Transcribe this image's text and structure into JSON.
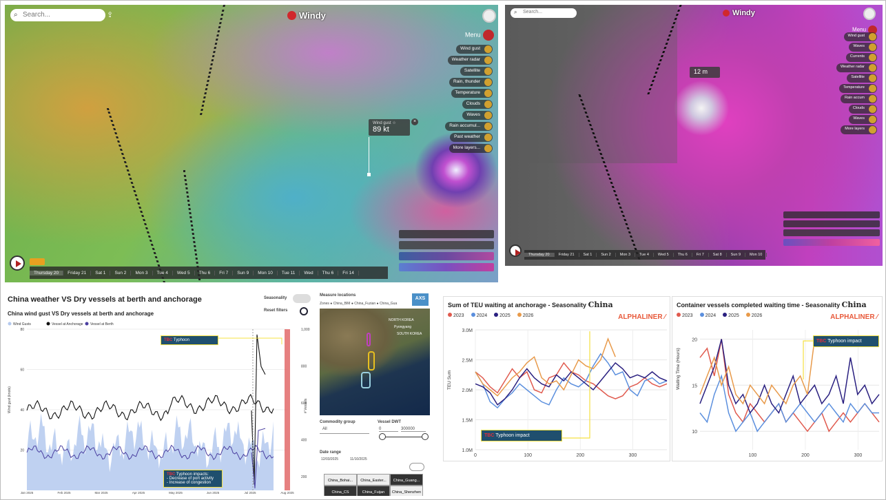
{
  "windy_left": {
    "search_placeholder": "Search...",
    "app_name": "Windy",
    "menu_label": "Menu",
    "layers": [
      "Wind gust",
      "Weather radar",
      "Satellite",
      "Rain, thunder",
      "Temperature",
      "Clouds",
      "Waves",
      "Rain accumul...",
      "Past weather",
      "More layers..."
    ],
    "popup_value": "89 kt",
    "popup_label": "Wind gust ☆",
    "timeline": [
      "Thursday 20",
      "Friday 21",
      "Sat 1",
      "Sun 2",
      "Mon 3",
      "Tue 4",
      "Wed 5",
      "Thu 6",
      "Fri 7",
      "Sun 9",
      "Mon 10",
      "Tue 11",
      "Wed",
      "Thu 6",
      "Fri 14"
    ]
  },
  "windy_right": {
    "search_placeholder": "Search...",
    "app_name": "Windy",
    "menu_label": "Menu",
    "layers": [
      "Wind gust",
      "Waves",
      "Currents",
      "Weather radar",
      "Satellite",
      "Temperature",
      "Rain accum",
      "Clouds",
      "Waves",
      "More layers"
    ],
    "popup_value": "12 m",
    "timeline": [
      "Thursday 20",
      "Friday 21",
      "Sat 1",
      "Sun 2",
      "Mon 3",
      "Tue 4",
      "Wed 5",
      "Thu 6",
      "Fri 7",
      "Sat 8",
      "Sun 9",
      "Mon 10"
    ]
  },
  "dashboard": {
    "title": "China weather VS Dry vessels at berth and anchorage",
    "subtitle": "China wind gust VS Dry vessels at berth and anchorage",
    "seasonality_label": "Seasonality",
    "reset_label": "Reset filters",
    "legend": [
      "Wind Gusts",
      "Vessel at Anchorage",
      "Vessel at Berth"
    ],
    "ylabel_left": "Wind gust (knots)",
    "ylabel_right": "# Vessels",
    "y_left_ticks": [
      "80",
      "60",
      "40",
      "20"
    ],
    "y_right_ticks": [
      "1,000",
      "800",
      "600",
      "400",
      "200"
    ],
    "x_ticks": [
      "Jan 2025",
      "Feb 2025",
      "Mar 2025",
      "Apr 2025",
      "May 2025",
      "Jun 2025",
      "Jul 2025",
      "Aug 2025"
    ],
    "annot_top": "Typhoon",
    "annot_top_red": "TBC",
    "annot_bottom_red": "TBC",
    "annot_bottom_lines": [
      "Typhoon impacts:",
      "- Decrease of port activity",
      "- Increase of congestion"
    ],
    "colors": {
      "wind": "#b4c9ee",
      "anchorage": "#111111",
      "berth": "#4a3fa0"
    }
  },
  "mapcard": {
    "title": "Measure locations",
    "zones_label": "Zones",
    "zones": [
      "China_BIM",
      "China_Fuzian",
      "China_Gua"
    ],
    "country_labels": [
      "NORTH KOREA",
      "Pyongyang",
      "SOUTH KOREA"
    ],
    "commodity_label": "Commodity group",
    "commodity_value": "All",
    "dwt_label": "Vessel DWT",
    "dwt_min": "0",
    "dwt_max": "300000",
    "date_label": "Date range",
    "date_from": "12/03/2025",
    "date_to": "11/10/2025",
    "buttons": [
      "China_Bohai...",
      "China_Easter...",
      "China_Guang...",
      "China_CS",
      "China_Fuijan",
      "China_Shenzhen"
    ],
    "badge": "AXS"
  },
  "chart_data": [
    {
      "type": "line",
      "title": "Sum of TEU waiting at anchorage - Seasonality",
      "title_suffix": "China",
      "brand": "ALPHALINER",
      "ylabel": "TEU Sum",
      "ylim": [
        1000000,
        3000000
      ],
      "y_ticks": [
        "3.0M",
        "2.5M",
        "2.0M",
        "1.5M",
        "1.0M"
      ],
      "xlim": [
        0,
        365
      ],
      "x_ticks": [
        "0",
        "100",
        "200",
        "300"
      ],
      "annotation_red": "TBC",
      "annotation": "Typhoon impact",
      "series": [
        {
          "name": "2023",
          "color": "#e05a4e",
          "values": [
            2.3,
            2.2,
            2.05,
            1.95,
            2.15,
            2.35,
            2.2,
            2.3,
            2.0,
            1.95,
            2.2,
            2.25,
            2.45,
            2.3,
            2.25,
            2.15,
            2.1,
            2.0,
            1.9,
            1.85,
            1.9,
            2.05,
            2.1,
            2.2,
            2.1,
            2.05,
            2.1
          ]
        },
        {
          "name": "2024",
          "color": "#5b8fde",
          "values": [
            2.3,
            2.1,
            1.8,
            1.7,
            1.85,
            1.95,
            2.1,
            2.0,
            1.9,
            1.8,
            1.75,
            2.0,
            2.2,
            2.1,
            2.05,
            2.15,
            2.4,
            2.6,
            2.45,
            2.25,
            2.3,
            2.0,
            1.9,
            2.15,
            2.2,
            2.1,
            2.15
          ]
        },
        {
          "name": "2025",
          "color": "#2a2080",
          "values": [
            2.1,
            2.05,
            1.95,
            1.75,
            1.85,
            2.0,
            2.2,
            2.35,
            2.2,
            2.1,
            2.05,
            2.25,
            2.15,
            2.3,
            2.2,
            2.1,
            2.0,
            2.15,
            2.3,
            2.45,
            2.35,
            2.2,
            2.25,
            2.2,
            2.3,
            2.2,
            2.15
          ]
        },
        {
          "name": "2026",
          "color": "#e89a4a",
          "values": [
            2.3,
            2.1,
            2.0,
            1.9,
            2.05,
            2.2,
            2.3,
            2.45,
            2.55,
            2.2,
            2.1,
            2.15,
            2.0,
            2.25,
            2.5,
            2.4,
            2.35,
            2.5,
            2.85,
            2.55
          ]
        }
      ]
    },
    {
      "type": "line",
      "title": "Container vessels completed waiting time - Seasonality",
      "title_suffix": "China",
      "brand": "ALPHALINER",
      "ylabel": "Waiting Time (Hours)",
      "ylim": [
        8,
        21
      ],
      "y_ticks": [
        "20",
        "15",
        "10"
      ],
      "xlim": [
        0,
        340
      ],
      "x_ticks": [
        "100",
        "200",
        "300"
      ],
      "annotation_red": "TBC",
      "annotation": "Typhoon impact",
      "series": [
        {
          "name": "2023",
          "color": "#e05a4e",
          "values": [
            18,
            19,
            16,
            20,
            14,
            12,
            11,
            13,
            12,
            11,
            12,
            13,
            11,
            12,
            11,
            10,
            11,
            12,
            10,
            11,
            12,
            11,
            12,
            13,
            12,
            11
          ]
        },
        {
          "name": "2024",
          "color": "#5b8fde",
          "values": [
            12,
            11,
            14,
            16,
            12,
            10,
            11,
            12,
            10,
            11,
            12,
            13,
            11,
            12,
            13,
            12,
            11,
            12,
            13,
            12,
            11,
            13,
            12,
            13,
            12,
            12
          ]
        },
        {
          "name": "2025",
          "color": "#2a2080",
          "values": [
            13,
            15,
            17,
            20,
            15,
            13,
            14,
            12,
            13,
            15,
            13,
            12,
            14,
            16,
            13,
            14,
            15,
            13,
            14,
            16,
            13,
            18,
            14,
            15,
            13,
            14
          ]
        },
        {
          "name": "2026",
          "color": "#e89a4a",
          "values": [
            14,
            16,
            18,
            15,
            17,
            14,
            13,
            15,
            14,
            13,
            15,
            14,
            13,
            15,
            16,
            14,
            20
          ]
        }
      ]
    }
  ]
}
